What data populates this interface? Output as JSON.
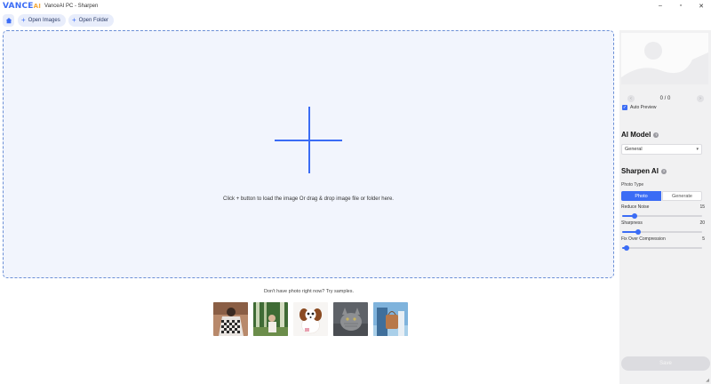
{
  "window": {
    "logo_text": "VANCE",
    "logo_ai": "AI",
    "title": "VanceAI PC - Sharpen",
    "minimize": "–",
    "maximize": "▫",
    "close": "✕"
  },
  "toolbar": {
    "open_images": "Open Images",
    "open_folder": "Open Folder"
  },
  "dropzone": {
    "instruction": "Click + button to load the image Or drag & drop image file or folder here."
  },
  "samples": {
    "label": "Don't have photo right now? Try samples.",
    "items": [
      "sample-woman-checkered",
      "sample-woman-forest",
      "sample-dog",
      "sample-cat",
      "sample-bag"
    ]
  },
  "panel": {
    "page_counter": "0 / 0",
    "auto_preview": "Auto Preview",
    "ai_model_title": "AI Model",
    "ai_model_value": "General",
    "sharpen_title": "Sharpen AI",
    "photo_type_label": "Photo Type",
    "photo_type_options": [
      "Photo",
      "Generate"
    ],
    "photo_type_selected": "Photo",
    "sliders": [
      {
        "label": "Reduce Noise",
        "value": "15",
        "fraction": 0.15
      },
      {
        "label": "Sharpness",
        "value": "20",
        "fraction": 0.2
      },
      {
        "label": "Fix Over Compression",
        "value": "5",
        "fraction": 0.05
      }
    ],
    "save_label": "Save"
  },
  "colors": {
    "accent": "#3b6cf5",
    "dropzone_bg": "#f2f5fd",
    "panel_bg": "#f1f1f2"
  }
}
